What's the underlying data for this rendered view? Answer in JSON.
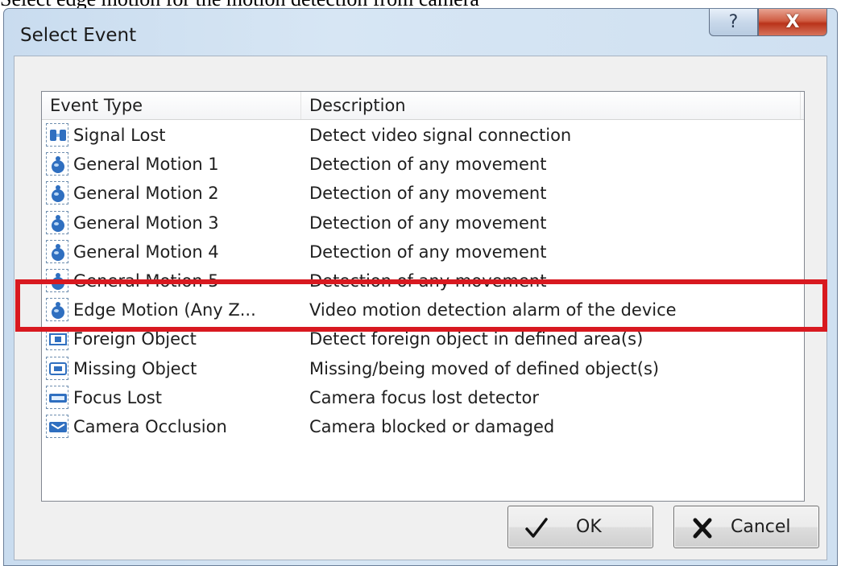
{
  "document": {
    "text": "Select edge motion for the motion detection from camera"
  },
  "dialog": {
    "title": "Select Event",
    "help_glyph": "?",
    "close_glyph": "X"
  },
  "list": {
    "columns": {
      "event_type": "Event Type",
      "description": "Description"
    },
    "rows": [
      {
        "type": "Signal Lost",
        "description": "Detect video signal connection",
        "icon": "signal-lost-icon"
      },
      {
        "type": "General Motion 1",
        "description": "Detection of any movement",
        "icon": "motion-icon"
      },
      {
        "type": "General Motion 2",
        "description": "Detection of any movement",
        "icon": "motion-icon"
      },
      {
        "type": "General Motion 3",
        "description": "Detection of any movement",
        "icon": "motion-icon"
      },
      {
        "type": "General Motion 4",
        "description": "Detection of any movement",
        "icon": "motion-icon"
      },
      {
        "type": "General Motion 5",
        "description": "Detection of any movement",
        "icon": "motion-icon"
      },
      {
        "type": "Edge Motion (Any Z...",
        "description": "Video motion detection alarm of the device",
        "icon": "motion-icon"
      },
      {
        "type": "Foreign Object",
        "description": "Detect foreign object in defined area(s)",
        "icon": "foreign-object-icon"
      },
      {
        "type": "Missing Object",
        "description": "Missing/being moved of defined object(s)",
        "icon": "missing-object-icon"
      },
      {
        "type": "Focus Lost",
        "description": "Camera focus lost detector",
        "icon": "focus-lost-icon"
      },
      {
        "type": "Camera Occlusion",
        "description": "Camera blocked or damaged",
        "icon": "camera-occlusion-icon"
      }
    ]
  },
  "buttons": {
    "ok": "OK",
    "cancel": "Cancel"
  },
  "colors": {
    "highlight": "#d81920",
    "icon_blue": "#2f6fc0"
  }
}
